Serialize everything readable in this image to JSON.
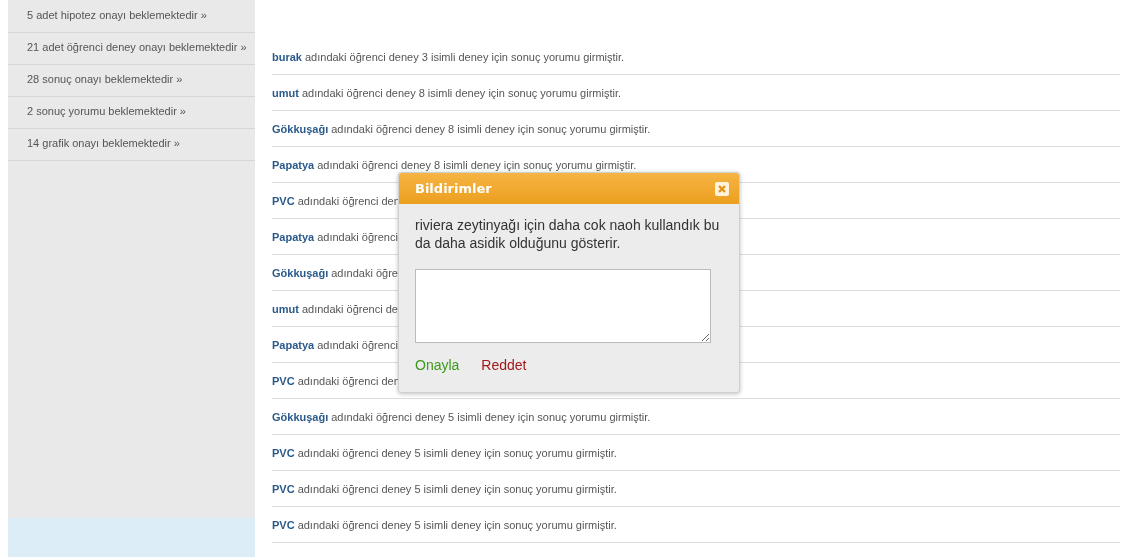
{
  "sidebar": {
    "items": [
      {
        "text": "5 adet hipotez onayı beklemektedir »"
      },
      {
        "text": "21 adet öğrenci deney onayı beklemektedir »"
      },
      {
        "text": "28 sonuç onayı beklemektedir »"
      },
      {
        "text": "2 sonuç yorumu beklemektedir »"
      },
      {
        "text": "14 grafik onayı beklemektedir »"
      }
    ]
  },
  "notifications": [
    {
      "name": "burak",
      "text": "adındaki öğrenci deney 3 isimli deney için sonuç yorumu girmiştir."
    },
    {
      "name": "umut",
      "text": "adındaki öğrenci deney 8 isimli deney için sonuç yorumu girmiştir."
    },
    {
      "name": "Gökkuşağı",
      "text": "adındaki öğrenci deney 8 isimli deney için sonuç yorumu girmiştir."
    },
    {
      "name": "Papatya",
      "text": "adındaki öğrenci deney 8 isimli deney için sonuç yorumu girmiştir."
    },
    {
      "name": "PVC",
      "text": "adındaki öğrenci den"
    },
    {
      "name": "Papatya",
      "text": "adındaki öğrenci"
    },
    {
      "name": "Gökkuşağı",
      "text": "adındaki öğre"
    },
    {
      "name": "umut",
      "text": "adındaki öğrenci de"
    },
    {
      "name": "Papatya",
      "text": "adındaki öğrenci"
    },
    {
      "name": "PVC",
      "text": "adındaki öğrenci den"
    },
    {
      "name": "Gökkuşağı",
      "text": "adındaki öğrenci deney 5 isimli deney için sonuç yorumu girmiştir."
    },
    {
      "name": "PVC",
      "text": "adındaki öğrenci deney 5 isimli deney için sonuç yorumu girmiştir."
    },
    {
      "name": "PVC",
      "text": "adındaki öğrenci deney 5 isimli deney için sonuç yorumu girmiştir."
    },
    {
      "name": "PVC",
      "text": "adındaki öğrenci deney 5 isimli deney için sonuç yorumu girmiştir."
    }
  ],
  "dialog": {
    "title": "Bildirimler",
    "message": "riviera zeytinyağı için daha cok naoh kullandık bu da daha asidik olduğunu gösterir.",
    "buttons": [
      {
        "label": "Onayla",
        "kind": "approve"
      },
      {
        "label": "Reddet",
        "kind": "reject"
      }
    ]
  }
}
